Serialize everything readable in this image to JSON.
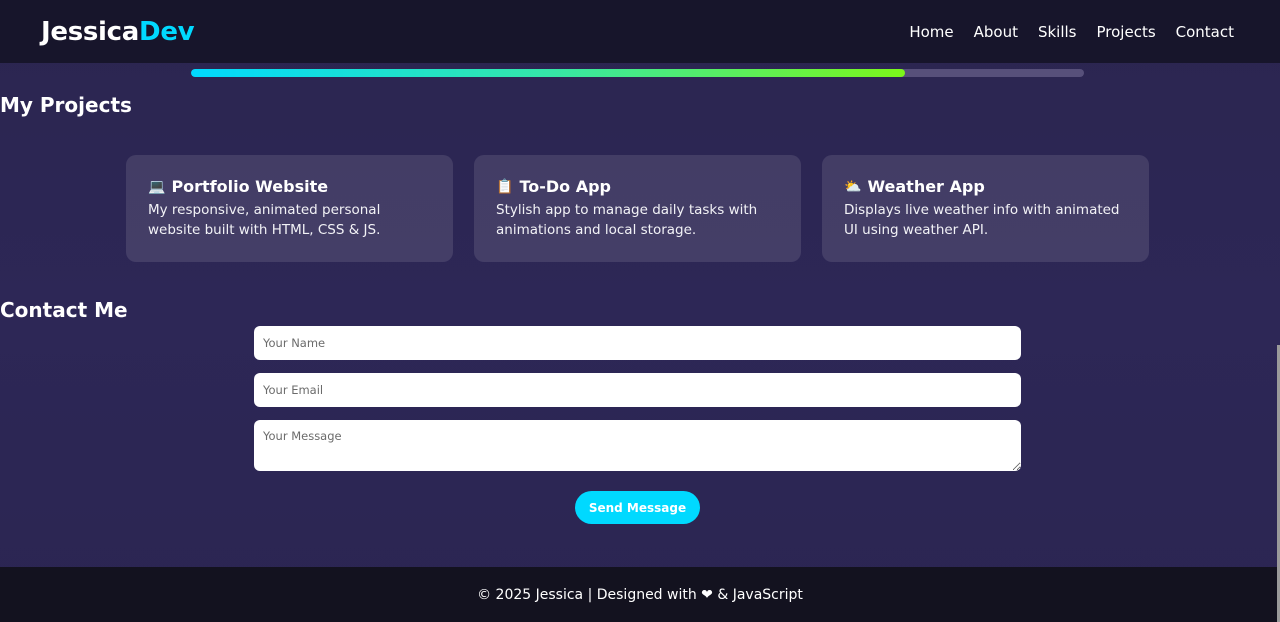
{
  "skills": {
    "progress_percent": 80
  },
  "header": {
    "logo_main": "Jessica",
    "logo_accent": "Dev",
    "nav": [
      "Home",
      "About",
      "Skills",
      "Projects",
      "Contact"
    ]
  },
  "projects": {
    "title": "My Projects",
    "cards": [
      {
        "icon": "💻",
        "icon_name": "laptop-icon",
        "title": "Portfolio Website",
        "description": "My responsive, animated personal website built with HTML, CSS & JS."
      },
      {
        "icon": "📋",
        "icon_name": "clipboard-icon",
        "title": "To-Do App",
        "description": "Stylish app to manage daily tasks with animations and local storage."
      },
      {
        "icon": "⛅",
        "icon_name": "weather-icon",
        "title": "Weather App",
        "description": "Displays live weather info with animated UI using weather API."
      }
    ]
  },
  "contact": {
    "title": "Contact Me",
    "name_placeholder": "Your Name",
    "email_placeholder": "Your Email",
    "message_placeholder": "Your Message",
    "send_label": "Send Message"
  },
  "footer": {
    "text": "© 2025 Jessica | Designed with ❤ & JavaScript"
  },
  "colors": {
    "accent": "#00d9ff",
    "background": "#2d2756",
    "footer": "#13121f"
  }
}
